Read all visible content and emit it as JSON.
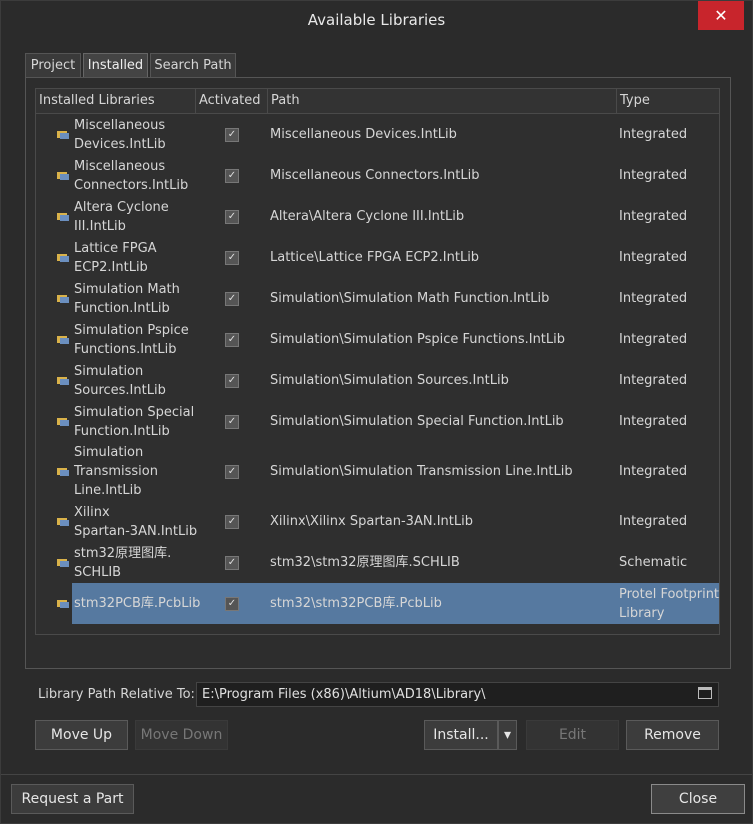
{
  "window": {
    "title": "Available Libraries",
    "close_glyph": "✕"
  },
  "tabs": [
    {
      "label": "Project"
    },
    {
      "label": "Installed"
    },
    {
      "label": "Search Path"
    }
  ],
  "table": {
    "headers": [
      "Installed Libraries",
      "Activated",
      "Path",
      "Type"
    ],
    "rows": [
      {
        "name": "Miscellaneous\nDevices.IntLib",
        "activated": true,
        "path": "Miscellaneous Devices.IntLib",
        "type": "Integrated",
        "icon": "integrated-library-icon"
      },
      {
        "name": "Miscellaneous\nConnectors.IntLib",
        "activated": true,
        "path": "Miscellaneous Connectors.IntLib",
        "type": "Integrated",
        "icon": "integrated-library-icon"
      },
      {
        "name": "Altera Cyclone\nIII.IntLib",
        "activated": true,
        "path": "Altera\\Altera Cyclone III.IntLib",
        "type": "Integrated",
        "icon": "integrated-library-icon"
      },
      {
        "name": "Lattice FPGA\nECP2.IntLib",
        "activated": true,
        "path": "Lattice\\Lattice FPGA ECP2.IntLib",
        "type": "Integrated",
        "icon": "integrated-library-icon"
      },
      {
        "name": "Simulation Math\nFunction.IntLib",
        "activated": true,
        "path": "Simulation\\Simulation Math Function.IntLib",
        "type": "Integrated",
        "icon": "integrated-library-icon"
      },
      {
        "name": "Simulation Pspice\nFunctions.IntLib",
        "activated": true,
        "path": "Simulation\\Simulation Pspice Functions.IntLib",
        "type": "Integrated",
        "icon": "integrated-library-icon"
      },
      {
        "name": "Simulation\nSources.IntLib",
        "activated": true,
        "path": "Simulation\\Simulation Sources.IntLib",
        "type": "Integrated",
        "icon": "integrated-library-icon"
      },
      {
        "name": "Simulation Special\nFunction.IntLib",
        "activated": true,
        "path": "Simulation\\Simulation Special Function.IntLib",
        "type": "Integrated",
        "icon": "integrated-library-icon"
      },
      {
        "name": "Simulation\nTransmission\nLine.IntLib",
        "activated": true,
        "path": "Simulation\\Simulation Transmission Line.IntLib",
        "type": "Integrated",
        "icon": "integrated-library-icon"
      },
      {
        "name": "Xilinx\nSpartan-3AN.IntLib",
        "activated": true,
        "path": "Xilinx\\Xilinx Spartan-3AN.IntLib",
        "type": "Integrated",
        "icon": "integrated-library-icon"
      },
      {
        "name": "stm32原理图库.\nSCHLIB",
        "activated": true,
        "path": "stm32\\stm32原理图库.SCHLIB",
        "type": "Schematic",
        "icon": "schematic-library-icon"
      },
      {
        "name": "stm32PCB库.PcbLib",
        "activated": true,
        "path": "stm32\\stm32PCB库.PcbLib",
        "type": "Protel Footprint\nLibrary",
        "icon": "pcb-library-icon",
        "selected": true
      }
    ]
  },
  "path_relative": {
    "label": "Library Path Relative To:",
    "value": "E:\\Program Files (x86)\\Altium\\AD18\\Library\\"
  },
  "buttons": {
    "move_up": "Move Up",
    "move_down": "Move Down",
    "install": "Install...",
    "install_dropdown": "▾",
    "edit": "Edit",
    "remove": "Remove",
    "request_part": "Request a Part",
    "close": "Close"
  },
  "colors": {
    "background": "#2b2b2b",
    "selection": "#5679a0",
    "close_button": "#c8252c"
  }
}
